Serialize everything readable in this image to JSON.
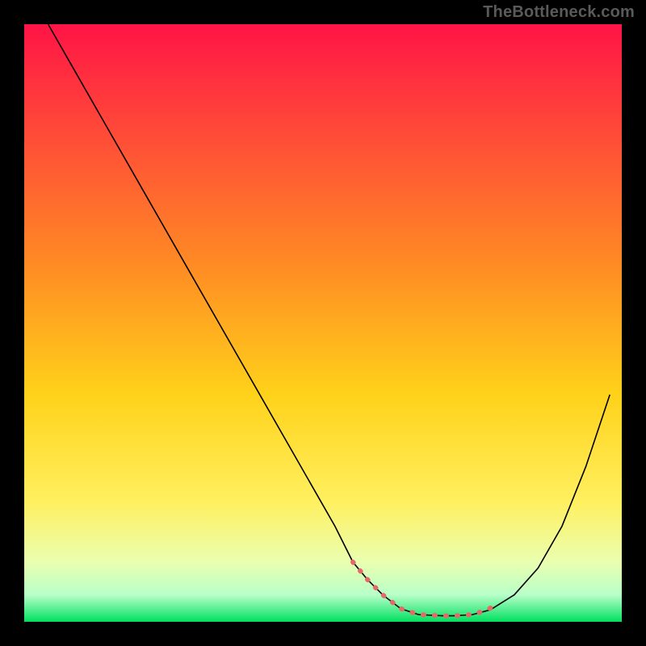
{
  "watermark": "TheBottleneck.com",
  "gradient": {
    "stops": [
      {
        "offset": 0.0,
        "color": "#ff1446"
      },
      {
        "offset": 0.18,
        "color": "#ff4a38"
      },
      {
        "offset": 0.4,
        "color": "#ff8a24"
      },
      {
        "offset": 0.62,
        "color": "#ffd21a"
      },
      {
        "offset": 0.8,
        "color": "#fff060"
      },
      {
        "offset": 0.9,
        "color": "#eaffb0"
      },
      {
        "offset": 0.955,
        "color": "#b8ffc8"
      },
      {
        "offset": 1.0,
        "color": "#00e060"
      }
    ]
  },
  "chart_data": {
    "type": "line",
    "title": "",
    "xlabel": "",
    "ylabel": "",
    "xlim": [
      0,
      100
    ],
    "ylim": [
      0,
      100
    ],
    "series": [
      {
        "name": "bottleneck-curve",
        "stroke": "#000000",
        "stroke_width": 1.6,
        "x": [
          4,
          8,
          12,
          16,
          20,
          24,
          28,
          32,
          36,
          40,
          44,
          48,
          52,
          55,
          57.5,
          60,
          63,
          66,
          70,
          72,
          75,
          78,
          82,
          86,
          90,
          94,
          98
        ],
        "y": [
          100,
          93,
          86,
          79,
          72,
          65,
          58,
          51,
          44,
          37,
          30,
          23,
          16,
          10,
          7,
          4.5,
          2.2,
          1.2,
          1.0,
          1.0,
          1.2,
          2.0,
          4.5,
          9,
          16,
          26,
          38
        ]
      },
      {
        "name": "dotted-band",
        "stroke": "#e46a6a",
        "stroke_width": 6,
        "dash": "1 13",
        "linecap": "round",
        "x": [
          55,
          57.5,
          60,
          63,
          66,
          70,
          72,
          75,
          77.5,
          79.5
        ],
        "y": [
          10,
          7,
          4.5,
          2.2,
          1.2,
          1.0,
          1.0,
          1.2,
          2.0,
          3.2
        ]
      }
    ]
  }
}
